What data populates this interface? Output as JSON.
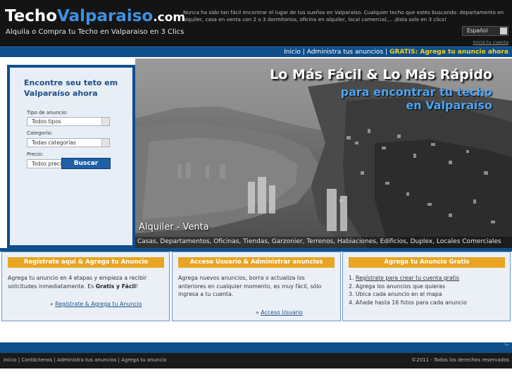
{
  "header": {
    "logo_part1": "Techo",
    "logo_part2": "Valparaiso",
    "logo_part3": ".com",
    "tagline": "Alquila o Compra tu Techo en Valparaiso en 3 Clics",
    "intro": "Nunca ha sido tan fácil encontrar el lugar de tus sueños en Valparaiso. Cualquier techo que estés buscando: departamento en alquiler, casa en venta con 2 o 3 dormitorios, oficina en alquiler, local comercial,... ¡Esta solo en 3 clics!",
    "language": "Español",
    "login_link": "Inicia tu cuenta"
  },
  "topnav": {
    "home": "Inicio",
    "separator": "|",
    "manage": "Administra tus anuncios",
    "gratis": "GRATIS: Agrega tu anuncio ahora"
  },
  "search": {
    "title": "Encontre seu teto em Valparaíso ahora",
    "type_label": "Tipo de anuncio:",
    "type_value": "Todos tipos",
    "category_label": "Categoría:",
    "category_value": "Todas categorías",
    "price_label": "Precio:",
    "price_value": "Todos precio",
    "button": "Buscar"
  },
  "hero": {
    "heading": "Lo Más Fácil & Lo Más Rápido",
    "sub1": "para encontrar tu techo",
    "sub2": "en Valparaíso",
    "modes": "Alquiler  -  Venta",
    "categories": "Casas, Departamentos, Oficinas, Tiendas, Garzonier, Terrenos, Habiaciones, Edificios, Duplex, Locales Comerciales"
  },
  "boxes": {
    "register": {
      "title": "Regístrate aquí & Agrega tu Anuncio",
      "text1": "Agrega tu anuncio en 4 etapas y empieza a recibir",
      "text2_a": "solicitudes inmediatamente. Es ",
      "text2_b": "Gratis y Fácil",
      "text2_c": "!",
      "link_prefix": "» ",
      "link": "Regístrate & Agrega tu Anuncio"
    },
    "access": {
      "title": "Acceso Usuario & Administrar anuncios",
      "text1": "Agrega nuevos anuncios, borra o actualiza los",
      "text2": "anteriores en cualquier momento, es muy fácil, sólo",
      "text3": "ingresa a tu cuenta.",
      "link_prefix": "» ",
      "link": "Acceso Usuario"
    },
    "free": {
      "title": "Agrega tu Anuncio Gratis",
      "step1_num": "1. ",
      "step1_link": "Regístrate para crear tu cuenta gratis",
      "step2": "2. Agrega los anuncios que quieras",
      "step3": "3. Ubica cada anuncio en el mapa",
      "step4": "4. Añade hasta 16 fotos para cada anuncio"
    }
  },
  "footer": {
    "links": "Inicio | Contáctenos | Administra tus anuncios | Agrega tu anuncio",
    "copyright": "©2011 - Todos los derechos reservados"
  }
}
